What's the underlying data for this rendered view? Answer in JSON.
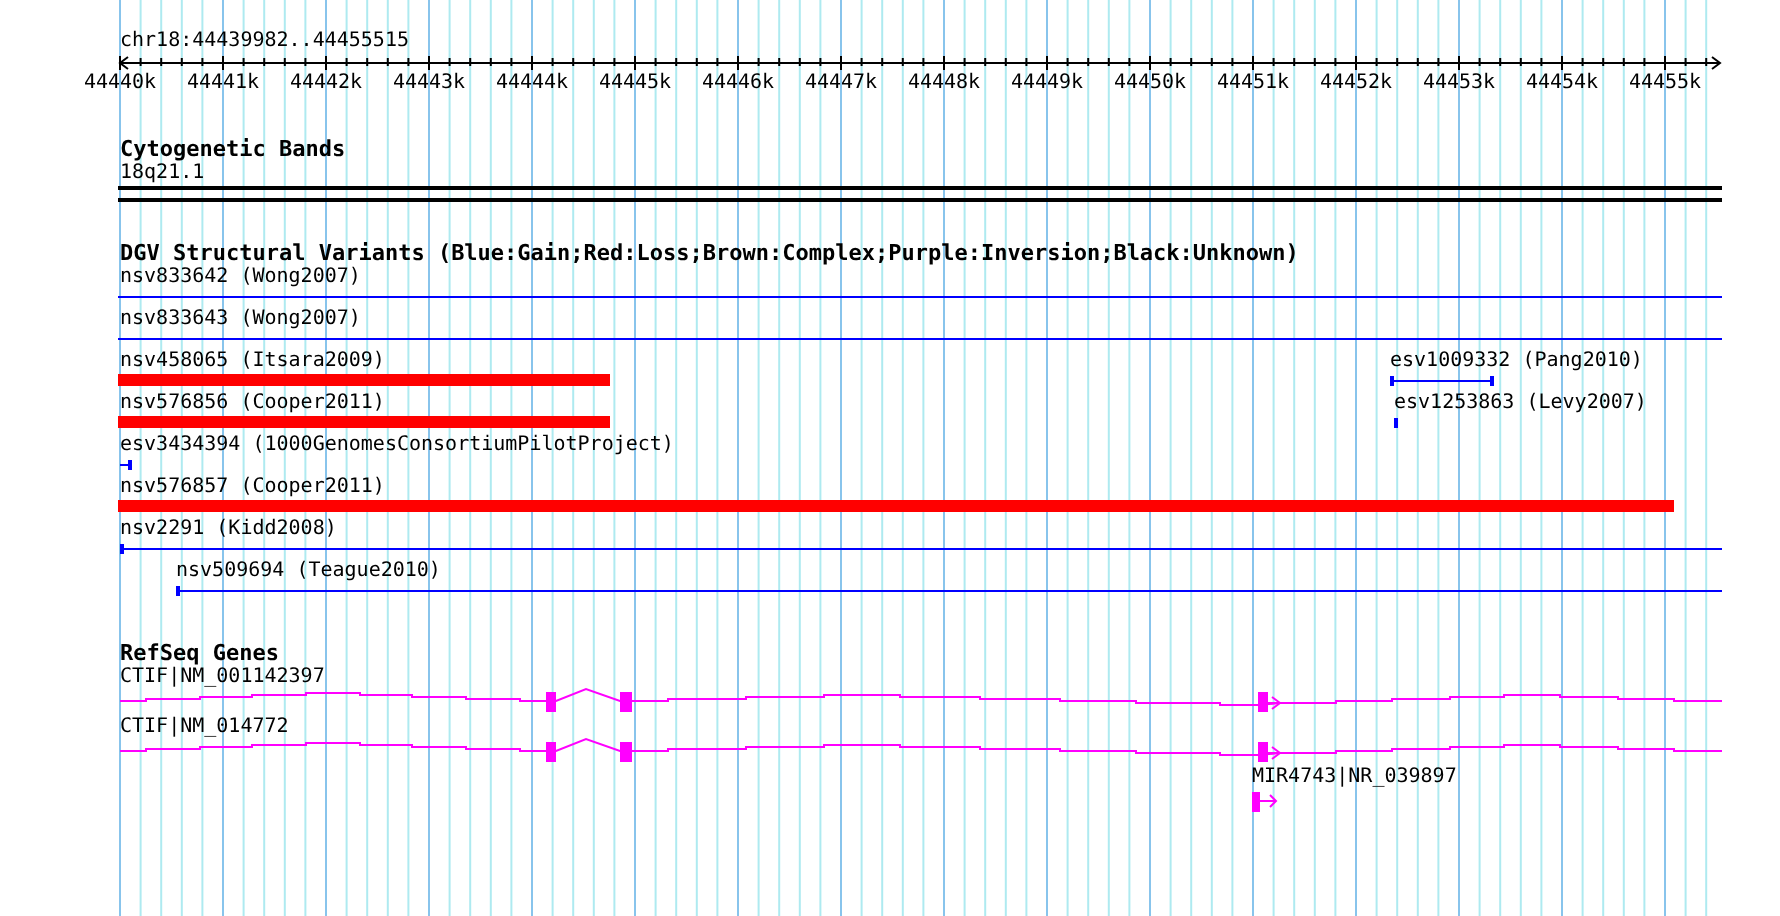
{
  "location": "chr18:44439982..44455515",
  "ruler": {
    "tick_labels": [
      "44440k",
      "44441k",
      "44442k",
      "44443k",
      "44444k",
      "44445k",
      "44446k",
      "44447k",
      "44448k",
      "44449k",
      "44450k",
      "44451k",
      "44452k",
      "44453k",
      "44454k",
      "44455k"
    ]
  },
  "tracks": [
    {
      "kind": "cytoband",
      "title": "Cytogenetic Bands",
      "features": [
        {
          "label": "18q21.1"
        }
      ]
    },
    {
      "kind": "variants",
      "title": "DGV Structural Variants (Blue:Gain;Red:Loss;Brown:Complex;Purple:Inversion;Black:Unknown)",
      "features": [
        {
          "label": "nsv833642 (Wong2007)",
          "kind": "gain",
          "color": "#0000ff"
        },
        {
          "label": "nsv833643 (Wong2007)",
          "kind": "gain",
          "color": "#0000ff"
        },
        {
          "label": "nsv458065 (Itsara2009)",
          "kind": "loss",
          "color": "#ff0000"
        },
        {
          "label": "esv1009332 (Pang2010)",
          "kind": "gain",
          "color": "#0000ff"
        },
        {
          "label": "nsv576856 (Cooper2011)",
          "kind": "loss",
          "color": "#ff0000"
        },
        {
          "label": "esv1253863 (Levy2007)",
          "kind": "gain",
          "color": "#0000ff"
        },
        {
          "label": "esv3434394 (1000GenomesConsortiumPilotProject)",
          "kind": "gain",
          "color": "#0000ff"
        },
        {
          "label": "nsv576857 (Cooper2011)",
          "kind": "loss",
          "color": "#ff0000"
        },
        {
          "label": "nsv2291 (Kidd2008)",
          "kind": "gain",
          "color": "#0000ff"
        },
        {
          "label": "nsv509694 (Teague2010)",
          "kind": "gain",
          "color": "#0000ff"
        }
      ]
    },
    {
      "kind": "genes",
      "title": "RefSeq Genes",
      "features": [
        {
          "label": "CTIF|NM_001142397",
          "kind": "mrna"
        },
        {
          "label": "CTIF|NM_014772",
          "kind": "mrna"
        },
        {
          "label": "MIR4743|NR_039897",
          "kind": "mirna"
        }
      ]
    }
  ]
}
